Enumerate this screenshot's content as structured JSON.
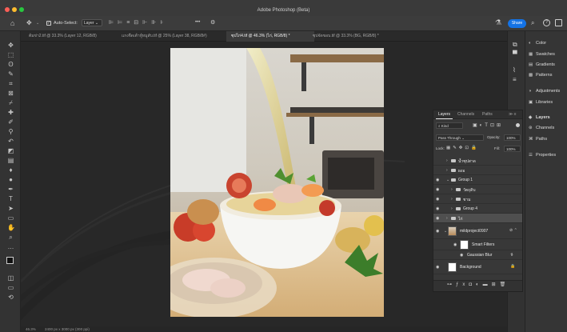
{
  "window": {
    "title": "Adobe Photoshop (Beta)",
    "traffic_lights": [
      "#fe5f57",
      "#febc2e",
      "#28c840"
    ]
  },
  "options_bar": {
    "auto_select_label": "Auto-Select:",
    "auto_select_value": "Layer",
    "more_label": "•••",
    "share_label": "Share",
    "share_color": "#1473e6"
  },
  "tabs": [
    {
      "label": "ต้มข่า2.tif @ 33.3% (Layer 12, RGB/8)",
      "active": false
    },
    {
      "label": "แกงจืดเต้าหู้หมูสับ.tif @ 25% (Layer 38, RGB/8#)",
      "active": false
    },
    {
      "label": "ซุปไก่4.tif @ 46.3% (ไก่, RGB/8) *",
      "active": true
    },
    {
      "label": "ซุปจัดขอบ.tif @ 33.3% (BG, RGB/8) *",
      "active": false
    }
  ],
  "right_dock": {
    "items": [
      {
        "label": "Color",
        "icon": "color-wheel-icon"
      },
      {
        "label": "Swatches",
        "icon": "swatches-grid-icon"
      },
      {
        "label": "Gradients",
        "icon": "gradient-icon"
      },
      {
        "label": "Patterns",
        "icon": "patterns-icon"
      },
      {
        "label": "Adjustments",
        "icon": "adjustments-icon"
      },
      {
        "label": "Libraries",
        "icon": "libraries-icon"
      },
      {
        "label": "Layers",
        "icon": "layers-icon"
      },
      {
        "label": "Channels",
        "icon": "channels-icon"
      },
      {
        "label": "Paths",
        "icon": "paths-icon"
      },
      {
        "label": "Properties",
        "icon": "properties-icon"
      }
    ]
  },
  "layers_panel": {
    "tabs": [
      {
        "label": "Layers",
        "active": true
      },
      {
        "label": "Channels",
        "active": false
      },
      {
        "label": "Paths",
        "active": false
      }
    ],
    "filter_kind": "Kind",
    "blend_mode": "Pass Through",
    "opacity_label": "Opacity:",
    "opacity_value": "100%",
    "lock_label": "Lock:",
    "fill_label": "Fill:",
    "fill_value": "100%",
    "layers": [
      {
        "name": "น้ำซุปสาด",
        "kind": "group",
        "visible": false,
        "indent": 0,
        "expanded": false
      },
      {
        "name": "ผงอ",
        "kind": "group",
        "visible": false,
        "indent": 0,
        "expanded": false
      },
      {
        "name": "Group 1",
        "kind": "group",
        "visible": true,
        "indent": 0,
        "expanded": true
      },
      {
        "name": "วัตถุดิบ",
        "kind": "group",
        "visible": true,
        "indent": 1,
        "expanded": false
      },
      {
        "name": "ชาม",
        "kind": "group",
        "visible": true,
        "indent": 1,
        "expanded": false
      },
      {
        "name": "Group 4",
        "kind": "group",
        "visible": true,
        "indent": 1,
        "expanded": false
      },
      {
        "name": "ไก่",
        "kind": "group",
        "visible": true,
        "indent": 0,
        "expanded": false,
        "selected": true
      },
      {
        "name": "mildproject0907",
        "kind": "smart",
        "visible": true,
        "indent": 0
      },
      {
        "name": "Smart Filters",
        "kind": "filter-mask",
        "visible": true,
        "indent": 1
      },
      {
        "name": "Gaussian Blur",
        "kind": "filter",
        "visible": true,
        "indent": 1
      },
      {
        "name": "Background",
        "kind": "background",
        "visible": true,
        "indent": 0
      }
    ]
  },
  "status_bar": {
    "zoom": "46.3%",
    "doc_size": "2400 px x 3000 px (300 ppi)"
  }
}
